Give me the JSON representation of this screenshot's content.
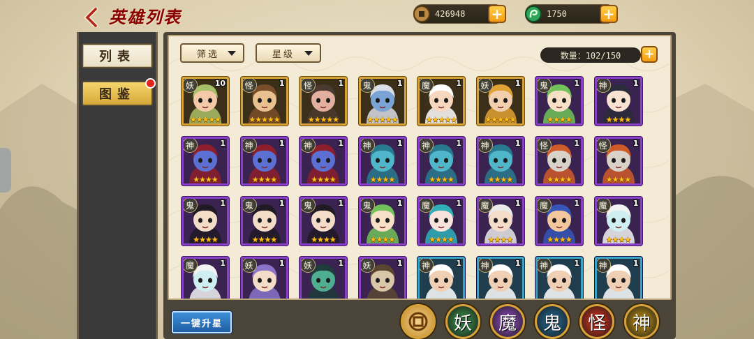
{
  "header": {
    "title": "英雄列表"
  },
  "currency": {
    "coins": "426948",
    "jade": "1750"
  },
  "left_nav": {
    "list_label": "列表",
    "atlas_label": "图鉴"
  },
  "filters": {
    "filter_label": "筛选",
    "star_label": "星级"
  },
  "count": {
    "label": "数量：102/150"
  },
  "bottom": {
    "upgrade_label": "一键升星"
  },
  "faction_tabs": [
    "妖",
    "魔",
    "鬼",
    "怪",
    "神"
  ],
  "heroes": [
    {
      "faction": "妖",
      "level": "10",
      "stars": "★★★★★",
      "frame": "gold",
      "skin": "#f3c9a8",
      "hair": "#a9c06a"
    },
    {
      "faction": "怪",
      "level": "1",
      "stars": "★★★★★",
      "frame": "gold",
      "skin": "#e9c08f",
      "hair": "#7a4d2a"
    },
    {
      "faction": "怪",
      "level": "1",
      "stars": "★★★★★",
      "frame": "gold",
      "skin": "#e3b0a0",
      "hair": "#4a3a30"
    },
    {
      "faction": "鬼",
      "level": "1",
      "stars": "★★★★★",
      "frame": "gold",
      "skin": "#7aa3d6",
      "hair": "#d8dde6"
    },
    {
      "faction": "魔",
      "level": "1",
      "stars": "★★★★★",
      "frame": "gold",
      "skin": "#f7d8bf",
      "hair": "#ffffff"
    },
    {
      "faction": "妖",
      "level": "1",
      "stars": "★★★★★",
      "frame": "gold",
      "skin": "#f2d0ae",
      "hair": "#e0a232"
    },
    {
      "faction": "鬼",
      "level": "1",
      "stars": "★★★★",
      "frame": "purple",
      "skin": "#f6e0c6",
      "hair": "#72c25a"
    },
    {
      "faction": "神",
      "level": "1",
      "stars": "★★★★",
      "frame": "purple",
      "skin": "#f8e2d2",
      "hair": "#2b2b3b"
    },
    {
      "faction": "神",
      "level": "1",
      "stars": "★★★★",
      "frame": "purple",
      "skin": "#5c6fd3",
      "hair": "#8d1f2c"
    },
    {
      "faction": "神",
      "level": "1",
      "stars": "★★★★",
      "frame": "purple",
      "skin": "#5c6fd3",
      "hair": "#8d1f2c"
    },
    {
      "faction": "神",
      "level": "1",
      "stars": "★★★★",
      "frame": "purple",
      "skin": "#5c6fd3",
      "hair": "#8d1f2c"
    },
    {
      "faction": "神",
      "level": "1",
      "stars": "★★★★",
      "frame": "purple",
      "skin": "#4fb7c9",
      "hair": "#2a7a8f"
    },
    {
      "faction": "神",
      "level": "1",
      "stars": "★★★★",
      "frame": "purple",
      "skin": "#4fb7c9",
      "hair": "#2a7a8f"
    },
    {
      "faction": "神",
      "level": "1",
      "stars": "★★★★",
      "frame": "purple",
      "skin": "#4fb7c9",
      "hair": "#2a7a8f"
    },
    {
      "faction": "怪",
      "level": "1",
      "stars": "★★★★",
      "frame": "purple",
      "skin": "#d9d2c8",
      "hair": "#cf5b2a"
    },
    {
      "faction": "怪",
      "level": "1",
      "stars": "★★★★",
      "frame": "purple",
      "skin": "#d9d2c8",
      "hair": "#cf5b2a"
    },
    {
      "faction": "鬼",
      "level": "1",
      "stars": "★★★★",
      "frame": "purple",
      "skin": "#f3ddc8",
      "hair": "#201a24"
    },
    {
      "faction": "鬼",
      "level": "1",
      "stars": "★★★★",
      "frame": "purple",
      "skin": "#f3ddc8",
      "hair": "#201a24"
    },
    {
      "faction": "鬼",
      "level": "1",
      "stars": "★★★★",
      "frame": "purple",
      "skin": "#f3ddc8",
      "hair": "#201a24"
    },
    {
      "faction": "鬼",
      "level": "1",
      "stars": "★★★★",
      "frame": "purple",
      "skin": "#f6e0c6",
      "hair": "#72c25a"
    },
    {
      "faction": "魔",
      "level": "1",
      "stars": "★★★★",
      "frame": "purple",
      "skin": "#f7e2dc",
      "hair": "#2fb0b8"
    },
    {
      "faction": "魔",
      "level": "1",
      "stars": "★★★★",
      "frame": "purple",
      "skin": "#f3dcc8",
      "hair": "#e9e9e9"
    },
    {
      "faction": "魔",
      "level": "1",
      "stars": "★★★★",
      "frame": "purple",
      "skin": "#f3c79d",
      "hair": "#3556b8"
    },
    {
      "faction": "魔",
      "level": "1",
      "stars": "★★★★",
      "frame": "purple",
      "skin": "#cfeef2",
      "hair": "#f2f2f2"
    },
    {
      "faction": "魔",
      "level": "1",
      "stars": "",
      "frame": "purple",
      "skin": "#cfeef2",
      "hair": "#f2f2f2"
    },
    {
      "faction": "妖",
      "level": "1",
      "stars": "",
      "frame": "purple",
      "skin": "#f3dcc8",
      "hair": "#8a73c9"
    },
    {
      "faction": "妖",
      "level": "1",
      "stars": "",
      "frame": "purple",
      "skin": "#4fae8f",
      "hair": "#1f3b3a"
    },
    {
      "faction": "妖",
      "level": "1",
      "stars": "",
      "frame": "purple",
      "skin": "#d9c8a8",
      "hair": "#5a4630"
    },
    {
      "faction": "神",
      "level": "1",
      "stars": "",
      "frame": "blue",
      "skin": "#f0d0b4",
      "hair": "#ffffff"
    },
    {
      "faction": "神",
      "level": "1",
      "stars": "",
      "frame": "blue",
      "skin": "#f0d0b4",
      "hair": "#ffffff"
    },
    {
      "faction": "神",
      "level": "1",
      "stars": "",
      "frame": "blue",
      "skin": "#f0d0b4",
      "hair": "#ffffff"
    },
    {
      "faction": "神",
      "level": "1",
      "stars": "",
      "frame": "blue",
      "skin": "#f0d0b4",
      "hair": "#ffffff"
    }
  ],
  "colors": {
    "accent_red": "#8b0000",
    "plus_gold": "#f39c12",
    "panel_cream": "#f3ebd6"
  }
}
